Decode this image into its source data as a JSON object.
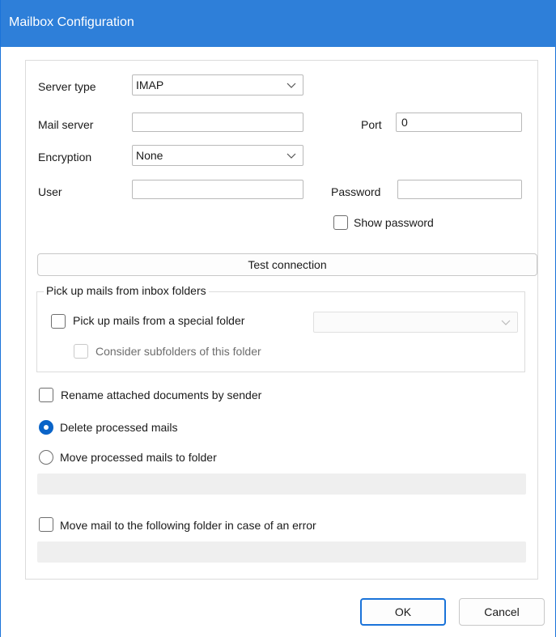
{
  "window": {
    "title": "Mailbox Configuration"
  },
  "server_type": {
    "label": "Server type",
    "value": "IMAP"
  },
  "mail_server": {
    "label": "Mail server",
    "value": ""
  },
  "port": {
    "label": "Port",
    "value": "0"
  },
  "encryption": {
    "label": "Encryption",
    "value": "None"
  },
  "user": {
    "label": "User",
    "value": ""
  },
  "password": {
    "label": "Password",
    "value": ""
  },
  "show_password": {
    "label": "Show password",
    "checked": false
  },
  "test_connection": {
    "label": "Test connection"
  },
  "inbox_group": {
    "legend": "Pick up mails from inbox folders",
    "special_folder": {
      "label": "Pick up mails from a special folder",
      "checked": false,
      "value": ""
    },
    "subfolders": {
      "label": "Consider subfolders of this folder",
      "checked": false,
      "disabled": true
    }
  },
  "rename_attachments": {
    "label": "Rename attached documents by sender",
    "checked": false
  },
  "delete_processed": {
    "label": "Delete processed mails",
    "selected": true
  },
  "move_processed": {
    "label": "Move processed mails to folder",
    "selected": false,
    "folder": ""
  },
  "move_on_error": {
    "label": "Move mail to the following folder in case of an error",
    "checked": false,
    "folder": ""
  },
  "footer": {
    "ok_label": "OK",
    "cancel_label": "Cancel"
  },
  "colors": {
    "titlebar": "#2e7fd9",
    "accent": "#0a64c8"
  }
}
